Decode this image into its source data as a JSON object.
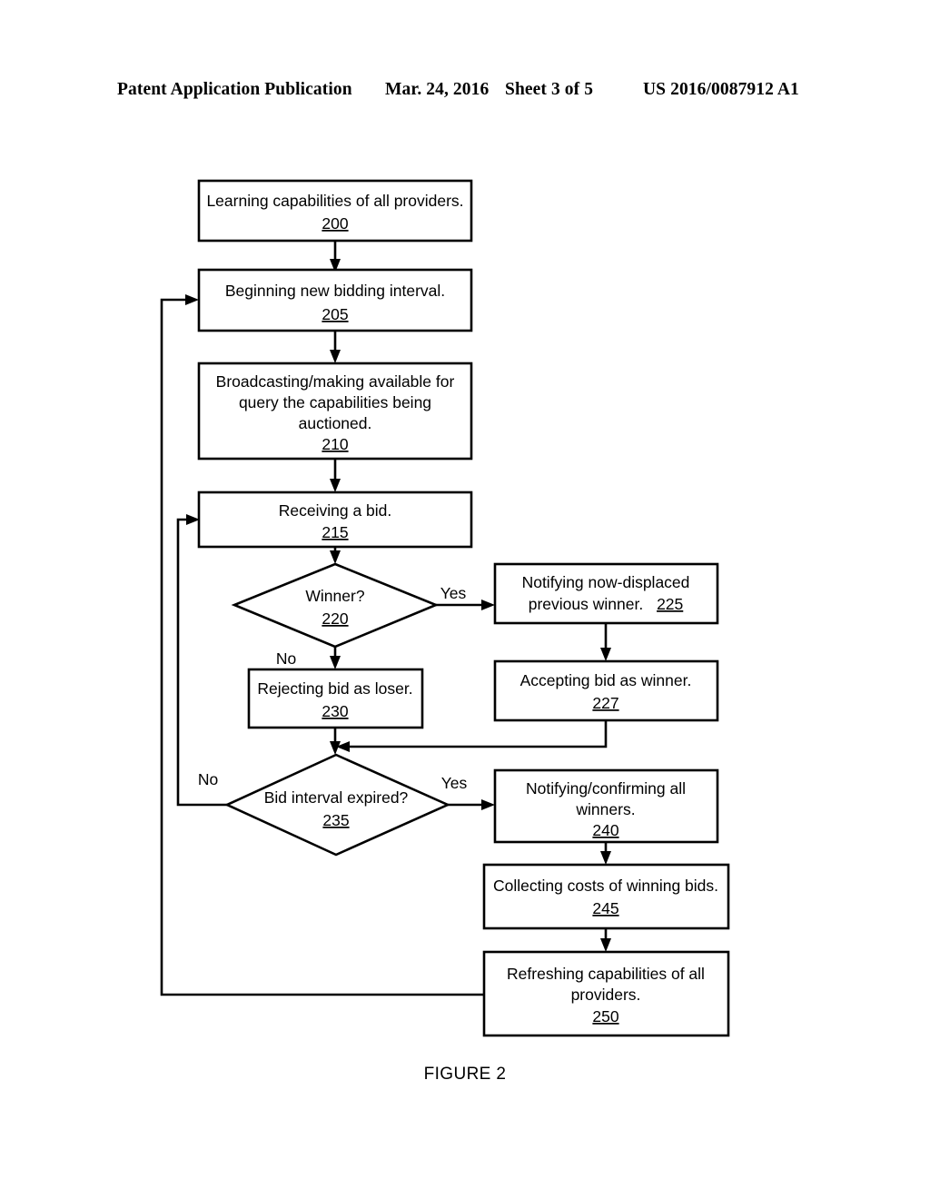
{
  "page": {
    "header": {
      "publication": "Patent Application Publication",
      "date": "Mar. 24, 2016",
      "sheet": "Sheet 3 of 5",
      "patent_number": "US 2016/0087912 A1"
    },
    "figure_caption": "FIGURE 2",
    "background_color": "#ffffff",
    "line_color": "#000000"
  },
  "flowchart": {
    "nodes": [
      {
        "id": "n200",
        "shape": "rect",
        "ref": "200",
        "lines": [
          "Learning capabilities of all providers."
        ]
      },
      {
        "id": "n205",
        "shape": "rect",
        "ref": "205",
        "lines": [
          "Beginning new bidding interval."
        ]
      },
      {
        "id": "n210",
        "shape": "rect",
        "ref": "210",
        "lines": [
          "Broadcasting/making available for",
          "query the capabilities being",
          "auctioned."
        ]
      },
      {
        "id": "n215",
        "shape": "rect",
        "ref": "215",
        "lines": [
          "Receiving a bid."
        ]
      },
      {
        "id": "n220",
        "shape": "diamond",
        "ref": "220",
        "lines": [
          "Winner?"
        ]
      },
      {
        "id": "n225",
        "shape": "rect",
        "ref": "225",
        "ref_inline": true,
        "lines": [
          "Notifying now-displaced",
          "previous winner."
        ]
      },
      {
        "id": "n227",
        "shape": "rect",
        "ref": "227",
        "lines": [
          "Accepting bid as winner."
        ]
      },
      {
        "id": "n230",
        "shape": "rect",
        "ref": "230",
        "lines": [
          "Rejecting bid as loser."
        ]
      },
      {
        "id": "n235",
        "shape": "diamond",
        "ref": "235",
        "lines": [
          "Bid interval expired?"
        ]
      },
      {
        "id": "n240",
        "shape": "rect",
        "ref": "240",
        "lines": [
          "Notifying/confirming all",
          "winners."
        ]
      },
      {
        "id": "n245",
        "shape": "rect",
        "ref": "245",
        "lines": [
          "Collecting costs of winning bids."
        ]
      },
      {
        "id": "n250",
        "shape": "rect",
        "ref": "250",
        "lines": [
          "Refreshing capabilities of all",
          "providers."
        ]
      }
    ],
    "edge_labels": {
      "winner_yes": "Yes",
      "winner_no": "No",
      "interval_yes": "Yes",
      "interval_no": "No"
    }
  }
}
